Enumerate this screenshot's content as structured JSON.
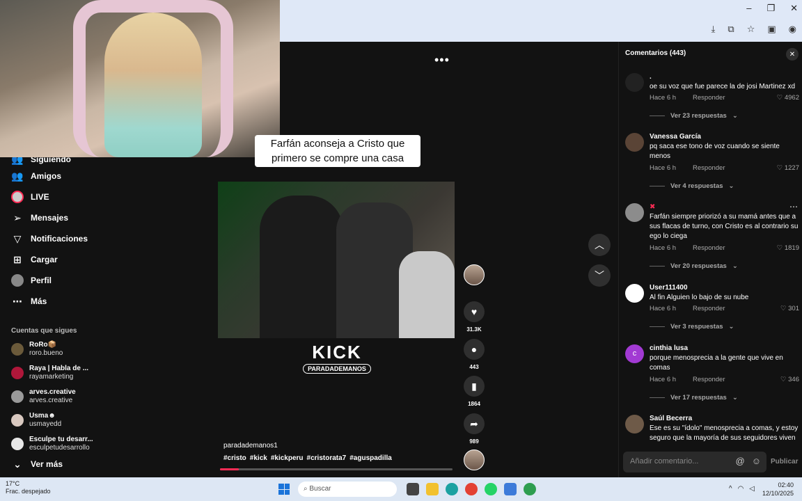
{
  "browser": {
    "window_controls": [
      "–",
      "❐",
      "✕"
    ],
    "toolbar_icons": [
      "download-icon",
      "extensions-icon",
      "favorites-icon",
      "tab-actions-icon",
      "profile-icon"
    ]
  },
  "sidebar": {
    "partial_top_item": "Siguiendo",
    "items": [
      {
        "label": "Amigos",
        "icon": "friends-icon"
      },
      {
        "label": "LIVE",
        "icon": "live-icon"
      },
      {
        "label": "Mensajes",
        "icon": "messages-icon"
      },
      {
        "label": "Notificaciones",
        "icon": "notifications-icon"
      },
      {
        "label": "Cargar",
        "icon": "upload-icon"
      },
      {
        "label": "Perfil",
        "icon": "profile-icon"
      },
      {
        "label": "Más",
        "icon": "more-icon"
      }
    ],
    "following_title": "Cuentas que sigues",
    "accounts": [
      {
        "name": "RoRo📦",
        "handle": "roro.bueno"
      },
      {
        "name": "Raya | Habla de ...",
        "handle": "rayamarketing"
      },
      {
        "name": "arves.creative",
        "handle": "arves.creative"
      },
      {
        "name": "Usma☻",
        "handle": "usmayedd"
      },
      {
        "name": "Esculpe tu desarr...",
        "handle": "esculpetudesarrollo"
      }
    ],
    "see_more": "Ver más"
  },
  "video": {
    "caption_line1": "Farfán aconseja a Cristo que",
    "caption_line2": "primero se compre una casa",
    "more_dots": "•••",
    "kick_logo": "KICK",
    "kick_tag": "PARADADEMANOS",
    "username": "paradademanos1",
    "tags": [
      "#cristo",
      "#kick",
      "#kickperu",
      "#cristorata7",
      "#aguspadilla"
    ],
    "progress_percent": 8
  },
  "actions": {
    "likes": "31.3K",
    "comments": "443",
    "saves": "1864",
    "shares": "989"
  },
  "comments_panel": {
    "title": "Comentarios (443)",
    "list": [
      {
        "name": ".",
        "text": "oe su voz que fue parece la de josi Martinez xd",
        "time": "Hace 6 h",
        "reply": "Responder",
        "likes": "4962",
        "replies": "Ver 23 respuestas",
        "avatar_color": "#222222"
      },
      {
        "name": "Vanessa García",
        "text": "pq saca ese tono de voz cuando se siente menos",
        "time": "Hace 6 h",
        "reply": "Responder",
        "likes": "1227",
        "replies": "Ver 4 respuestas",
        "avatar_color": "#5a4436"
      },
      {
        "name": "✖",
        "text": "Farfán siempre priorizó a su mamá antes que a sus flacas de turno, con Cristo es al contrario su ego lo ciega",
        "time": "Hace 6 h",
        "reply": "Responder",
        "likes": "1819",
        "replies": "Ver 20 respuestas",
        "avatar_color": "#8c8c8c"
      },
      {
        "name": "User111400",
        "text": "Al fin Alguien lo bajo de su nube",
        "time": "Hace 6 h",
        "reply": "Responder",
        "likes": "301",
        "replies": "Ver 3 respuestas",
        "avatar_color": "#ffffff"
      },
      {
        "name": "cinthia lusa",
        "text": "porque menosprecia a la gente que vive en comas",
        "time": "Hace 6 h",
        "reply": "Responder",
        "likes": "346",
        "replies": "Ver 17 respuestas",
        "avatar_color": "#a23ad3"
      },
      {
        "name": "Saúl Becerra",
        "text": "Ese es su \"ídolo\" menosprecia a comas, y estoy seguro que la mayoría de sus seguidores viven",
        "time": "",
        "reply": "",
        "likes": "",
        "replies": "",
        "avatar_color": "#6e5a48"
      }
    ],
    "input_placeholder": "Añadir comentario...",
    "publish_label": "Publicar"
  },
  "taskbar": {
    "temperature": "17°C",
    "weather": "Frac. despejado",
    "search_placeholder": "Buscar",
    "time": "02:40",
    "date": "12/10/2025"
  },
  "colors": {
    "accent": "#fe2c55",
    "panel": "#121212",
    "chrome": "#dfe8f7"
  }
}
